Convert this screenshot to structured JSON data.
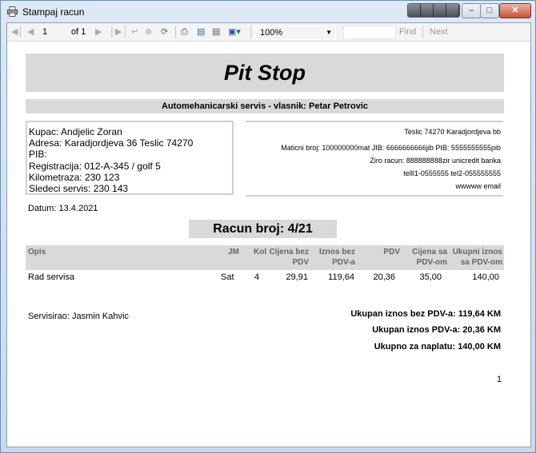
{
  "window": {
    "title": "Stampaj racun"
  },
  "toolbar": {
    "page_input": "1",
    "page_of": "of 1",
    "zoom": "100%",
    "find_label": "Find",
    "next_label": "Next"
  },
  "report": {
    "title": "Pit Stop",
    "subheader": "Automehanicarski servis   - vlasnik: Petar Petrovic",
    "customer": {
      "kupac": "Kupac: Andjelic Zoran",
      "adresa": "Adresa: Karadjordjeva 36 Teslic 74270",
      "pib": "PIB:",
      "registracija": "Registracija: 012-A-345 / golf 5",
      "kilometraza": "Kilometraza: 230 123",
      "sledeci": "Sledeci servis: 230 143"
    },
    "company": {
      "address": "Teslic 74270 Karadjordjeva bb",
      "ids": "Maticni broj: 100000000mat JIB: 6666666666jib PIB: 5555555555pib",
      "ziro": "Ziro racun: 888888888zir unicredit banka",
      "tel": "telll1-0555555 tel2-055555555",
      "email": "wwwww email"
    },
    "datum": "Datum: 13.4.2021",
    "racun_broj": "Racun broj: 4/21",
    "table": {
      "headers": {
        "opis": "Opis",
        "jm": "JM",
        "kol": "Kol",
        "cijena_bez_1": "Cijena bez",
        "cijena_bez_2": "PDV",
        "iznos_bez_1": "Iznos bez",
        "iznos_bez_2": "PDV-a",
        "pdv": "PDV",
        "cijena_sa_1": "Cijena sa",
        "cijena_sa_2": "PDV-om",
        "ukupni_1": "Ukupni iznos",
        "ukupni_2": "sa PDV-om"
      },
      "rows": [
        {
          "opis": "Rad servisa",
          "jm": "Sat",
          "kol": "4",
          "cijena_bez": "29,91",
          "iznos_bez": "119,64",
          "pdv": "20,36",
          "cijena_sa": "35,00",
          "ukupno": "140,00"
        }
      ]
    },
    "servisirao": "Servisirao: Jasmin Kahvic",
    "totals": {
      "bez_pdv": "Ukupan iznos bez PDV-a:  119,64 KM",
      "pdv": "Ukupan iznos PDV-a: 20,36 KM",
      "za_naplatu": "Ukupno za naplatu: 140,00 KM"
    },
    "page_number": "1"
  },
  "icons": [
    "printer-icon",
    "first-page-icon",
    "prev-page-icon",
    "next-page-icon",
    "last-page-icon",
    "back-icon",
    "stop-icon",
    "refresh-icon",
    "print-icon",
    "print-layout-icon",
    "page-setup-icon",
    "export-icon"
  ]
}
